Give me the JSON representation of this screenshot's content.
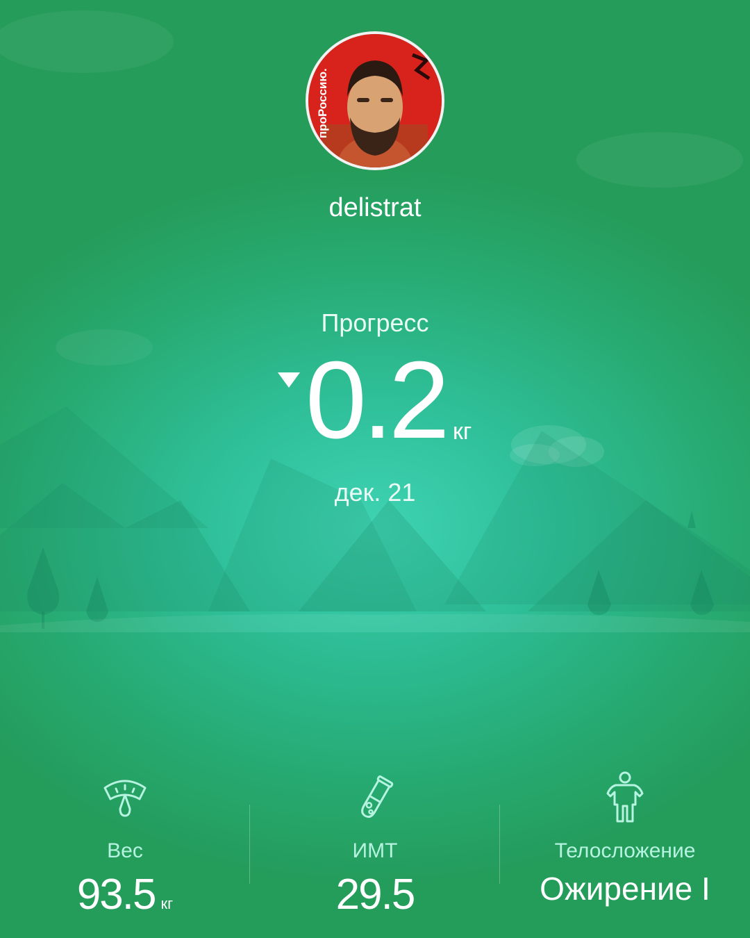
{
  "profile": {
    "username": "delistrat",
    "avatar_caption": "проРоссию.",
    "avatar_bg_color": "#d8231c"
  },
  "progress": {
    "label": "Прогресс",
    "direction_icon": "triangle-down-icon",
    "value": "0.2",
    "unit": "кг",
    "date": "дек. 21"
  },
  "stats": [
    {
      "icon": "scale-icon",
      "label": "Вес",
      "value": "93.5",
      "unit": "кг"
    },
    {
      "icon": "flask-icon",
      "label": "ИМТ",
      "value": "29.5",
      "unit": ""
    },
    {
      "icon": "body-figure-icon",
      "label": "Телосложение",
      "value": "Ожирение I",
      "unit": ""
    }
  ],
  "colors": {
    "background_center": "#3fd3b3",
    "background_edge": "#259c5a",
    "label_mint": "#b6f3e0",
    "text": "#ffffff"
  }
}
